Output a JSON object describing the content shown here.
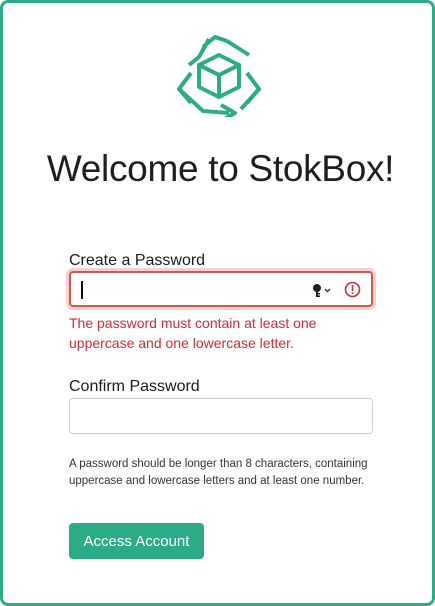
{
  "app": {
    "title": "Welcome to StokBox!",
    "logo_icon": "recycle-cube-icon",
    "brand_color": "#2bac87"
  },
  "form": {
    "create_password": {
      "label": "Create a Password",
      "value": "",
      "state": "invalid",
      "error": "The password must contain at least one uppercase and one lowercase letter.",
      "icons": [
        "key-icon",
        "alert-circle-icon"
      ]
    },
    "confirm_password": {
      "label": "Confirm Password",
      "value": ""
    },
    "help_text": "A password should be longer than 8 characters, containing uppercase and lowercase letters and at least one number.",
    "submit_label": "Access Account"
  },
  "colors": {
    "error": "#d42a35",
    "error_border": "#d9534f",
    "accent": "#2bac87"
  }
}
